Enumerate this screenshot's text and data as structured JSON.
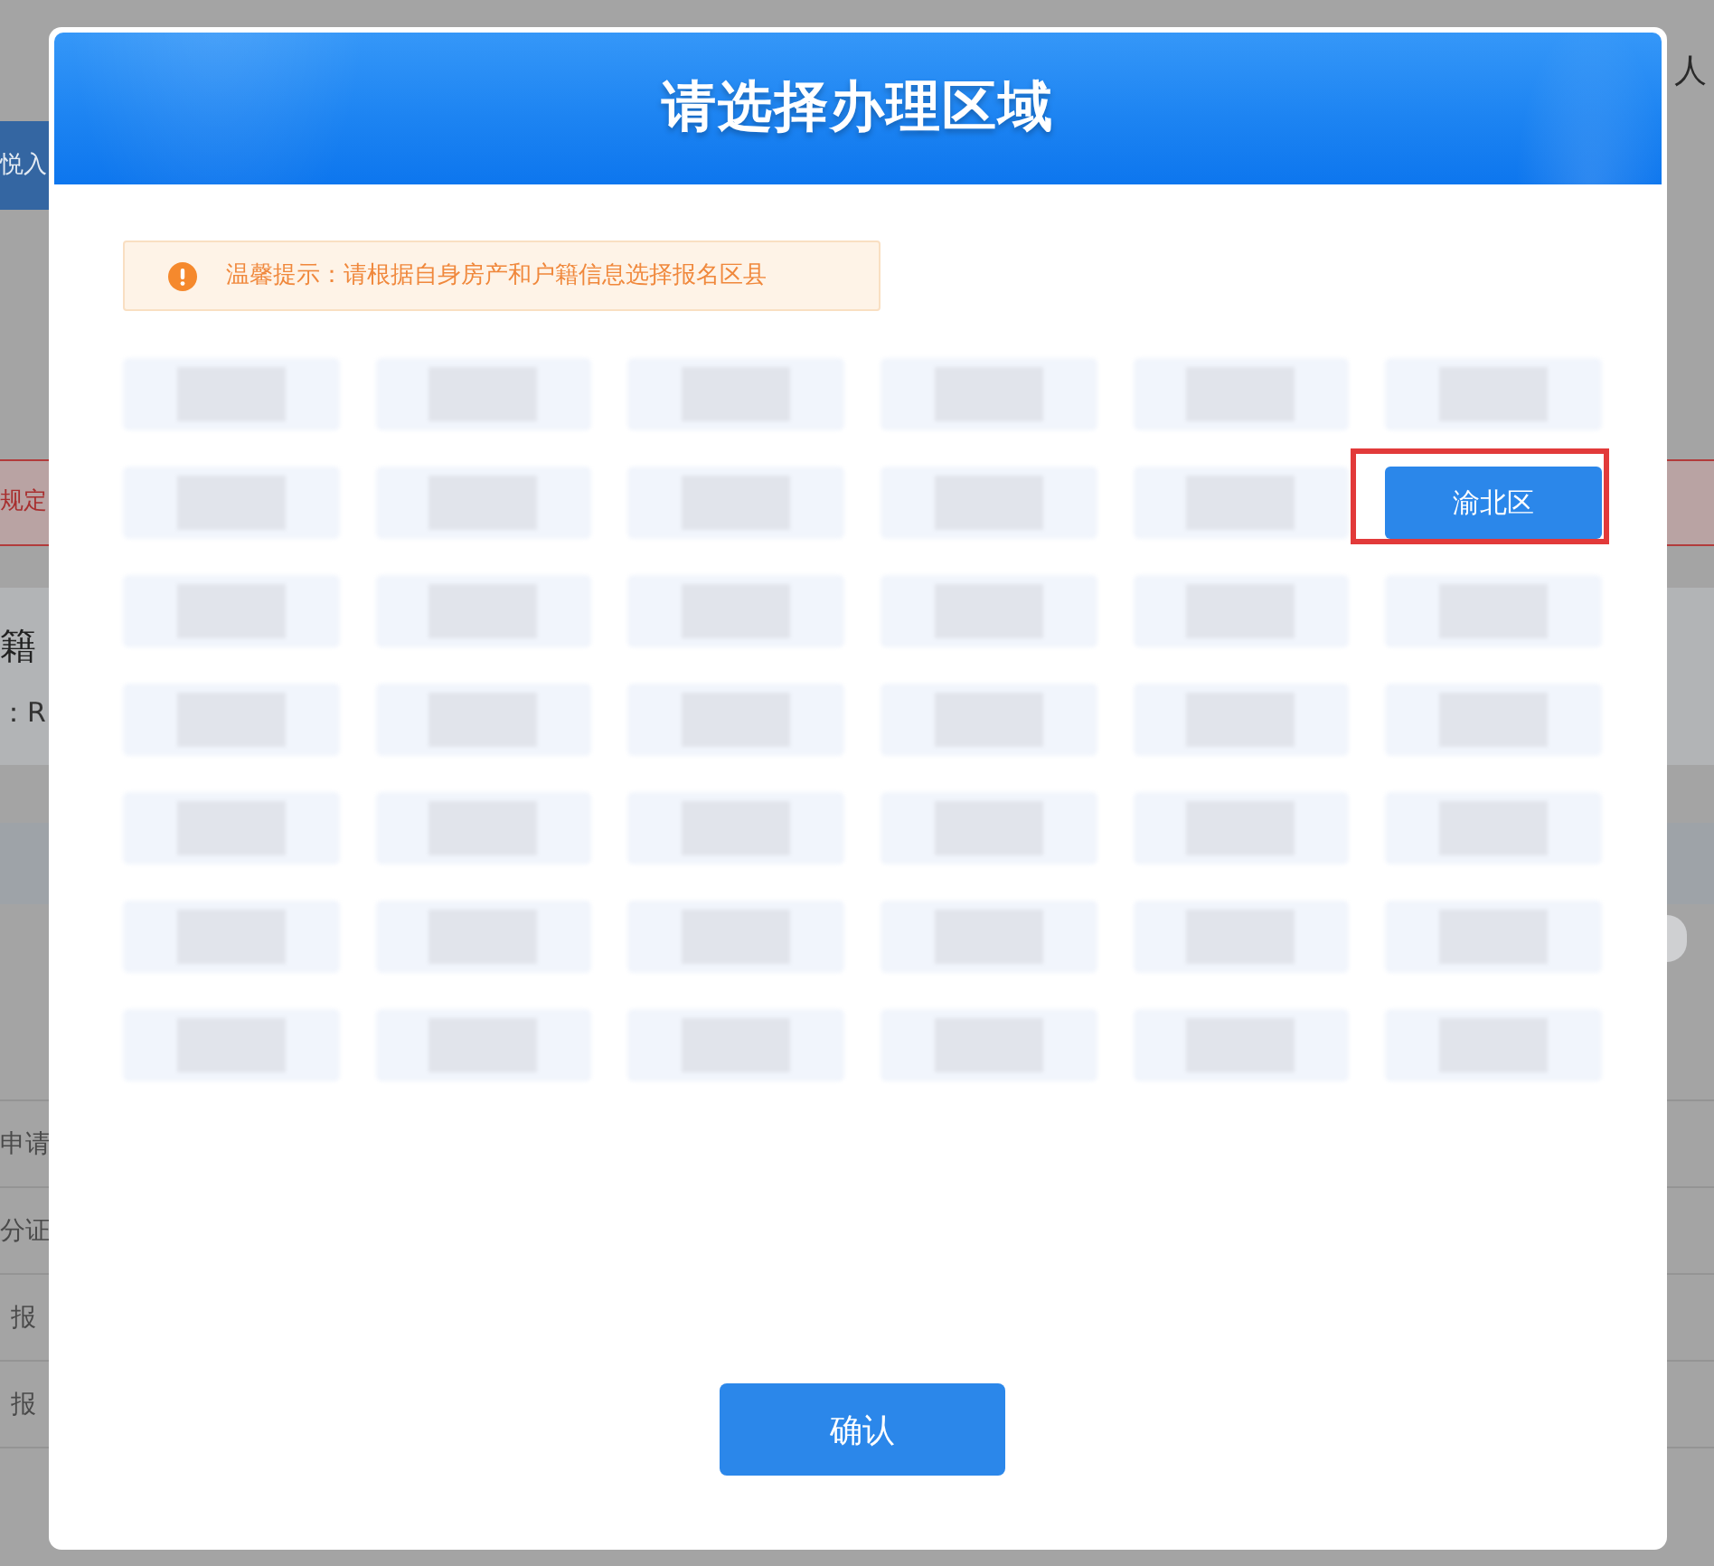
{
  "background_page": {
    "header_text": "人",
    "banner_text": "悦入",
    "alert_text": "规定",
    "card_title": "籍",
    "card_subtitle": "：R",
    "form_labels": [
      {
        "text": "申请",
        "indented": false
      },
      {
        "text": "分证",
        "indented": false
      },
      {
        "text": "报",
        "indented": true
      },
      {
        "text": "报",
        "indented": true
      }
    ]
  },
  "dialog": {
    "title": "请选择办理区域",
    "tip": {
      "text": "温馨提示：请根据自身房产和户籍信息选择报名区县"
    },
    "districts": [
      {
        "kind": "redacted",
        "selected": false,
        "highlighted": false
      },
      {
        "kind": "redacted",
        "selected": false,
        "highlighted": false
      },
      {
        "kind": "redacted",
        "selected": false,
        "highlighted": false
      },
      {
        "kind": "redacted",
        "selected": false,
        "highlighted": false
      },
      {
        "kind": "redacted",
        "selected": false,
        "highlighted": false
      },
      {
        "kind": "redacted",
        "selected": false,
        "highlighted": false
      },
      {
        "kind": "redacted",
        "selected": false,
        "highlighted": false
      },
      {
        "kind": "redacted",
        "selected": false,
        "highlighted": false
      },
      {
        "kind": "redacted",
        "selected": false,
        "highlighted": false
      },
      {
        "kind": "redacted",
        "selected": false,
        "highlighted": false
      },
      {
        "kind": "redacted",
        "selected": false,
        "highlighted": false
      },
      {
        "kind": "district",
        "label": "渝北区",
        "selected": true,
        "highlighted": true
      },
      {
        "kind": "redacted",
        "selected": false,
        "highlighted": false
      },
      {
        "kind": "redacted",
        "selected": false,
        "highlighted": false
      },
      {
        "kind": "redacted",
        "selected": false,
        "highlighted": false
      },
      {
        "kind": "redacted",
        "selected": false,
        "highlighted": false
      },
      {
        "kind": "redacted",
        "selected": false,
        "highlighted": false
      },
      {
        "kind": "redacted",
        "selected": false,
        "highlighted": false
      },
      {
        "kind": "redacted",
        "selected": false,
        "highlighted": false
      },
      {
        "kind": "redacted",
        "selected": false,
        "highlighted": false
      },
      {
        "kind": "redacted",
        "selected": false,
        "highlighted": false
      },
      {
        "kind": "redacted",
        "selected": false,
        "highlighted": false
      },
      {
        "kind": "redacted",
        "selected": false,
        "highlighted": false
      },
      {
        "kind": "redacted",
        "selected": false,
        "highlighted": false
      },
      {
        "kind": "redacted",
        "selected": false,
        "highlighted": false
      },
      {
        "kind": "redacted",
        "selected": false,
        "highlighted": false
      },
      {
        "kind": "redacted",
        "selected": false,
        "highlighted": false
      },
      {
        "kind": "redacted",
        "selected": false,
        "highlighted": false
      },
      {
        "kind": "redacted",
        "selected": false,
        "highlighted": false
      },
      {
        "kind": "redacted",
        "selected": false,
        "highlighted": false
      },
      {
        "kind": "redacted",
        "selected": false,
        "highlighted": false
      },
      {
        "kind": "redacted",
        "selected": false,
        "highlighted": false
      },
      {
        "kind": "redacted",
        "selected": false,
        "highlighted": false
      },
      {
        "kind": "redacted",
        "selected": false,
        "highlighted": false
      },
      {
        "kind": "redacted",
        "selected": false,
        "highlighted": false
      },
      {
        "kind": "redacted",
        "selected": false,
        "highlighted": false
      },
      {
        "kind": "redacted",
        "selected": false,
        "highlighted": false
      },
      {
        "kind": "redacted",
        "selected": false,
        "highlighted": false
      },
      {
        "kind": "redacted",
        "selected": false,
        "highlighted": false
      },
      {
        "kind": "redacted",
        "selected": false,
        "highlighted": false
      },
      {
        "kind": "redacted",
        "selected": false,
        "highlighted": false
      },
      {
        "kind": "redacted",
        "selected": false,
        "highlighted": false
      }
    ],
    "confirm_button": "确认"
  }
}
